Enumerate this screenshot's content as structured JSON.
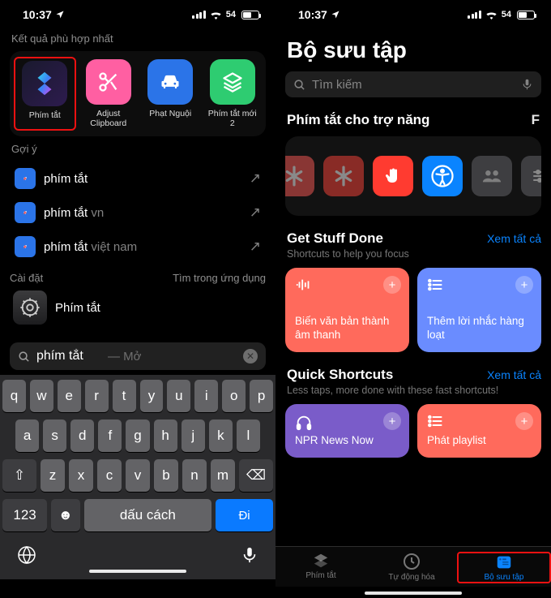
{
  "statusbar": {
    "time": "10:37",
    "battery": "54"
  },
  "left": {
    "best_label": "Kết quả phù hợp nhất",
    "apps": [
      {
        "name": "Phím tắt",
        "bg": "linear-gradient(135deg,#1a1a2e,#2d1b4e)",
        "icon": "shortcuts"
      },
      {
        "name": "Adjust Clipboard",
        "bg": "#ff5fa2",
        "icon": "scissors"
      },
      {
        "name": "Phạt Nguội",
        "bg": "#2b74e8",
        "icon": "car"
      },
      {
        "name": "Phím tắt mới 2",
        "bg": "#2ecc71",
        "icon": "layers"
      }
    ],
    "sugg_label": "Gợi ý",
    "suggestions": [
      {
        "main": "phím tắt",
        "sub": ""
      },
      {
        "main": "phím tắt",
        "sub": " vn"
      },
      {
        "main": "phím tắt",
        "sub": " việt nam"
      }
    ],
    "settings_label": "Cài đặt",
    "search_in_app": "Tìm trong ứng dụng",
    "settings_item": "Phím tắt",
    "search_value": "phím tắt",
    "search_hint": "— Mở",
    "keyboard": {
      "r1": [
        "q",
        "w",
        "e",
        "r",
        "t",
        "y",
        "u",
        "i",
        "o",
        "p"
      ],
      "r2": [
        "a",
        "s",
        "d",
        "f",
        "g",
        "h",
        "j",
        "k",
        "l"
      ],
      "r3_shift": "⇧",
      "r3_keys": [
        "z",
        "x",
        "c",
        "v",
        "b",
        "n",
        "m"
      ],
      "r3_del": "⌫",
      "num": "123",
      "emoji": "☻",
      "space": "dấu cách",
      "go": "Đi"
    }
  },
  "right": {
    "title": "Bộ sưu tập",
    "search_ph": "Tìm kiếm",
    "sect_a11y": "Phím tắt cho trợ năng",
    "peek_letter": "F",
    "a11y_items": [
      {
        "bg": "#ff5b57"
      },
      {
        "bg": "#ff453a"
      },
      {
        "bg": "#ff3b30"
      },
      {
        "bg": "#0a84ff",
        "active": true
      },
      {
        "bg": "#6b6b70"
      },
      {
        "bg": "#6b6b70"
      }
    ],
    "gsd": {
      "heading": "Get Stuff Done",
      "sub": "Shortcuts to help you focus",
      "see_all": "Xem tất cả",
      "cards": [
        {
          "bg": "#ff6a5c",
          "title": "Biến văn bản thành âm thanh",
          "icon": "wave"
        },
        {
          "bg": "#6a8cff",
          "title": "Thêm lời nhắc hàng loạt",
          "icon": "list"
        }
      ]
    },
    "qs": {
      "heading": "Quick Shortcuts",
      "sub": "Less taps, more done with these fast shortcuts!",
      "see_all": "Xem tất cả",
      "cards": [
        {
          "bg": "#7a5cc9",
          "title": "NPR News Now",
          "icon": "headphones"
        },
        {
          "bg": "#ff6a5c",
          "title": "Phát playlist",
          "icon": "list"
        }
      ]
    },
    "tabs": [
      {
        "label": "Phím tắt",
        "icon": "stack"
      },
      {
        "label": "Tự động hóa",
        "icon": "clock"
      },
      {
        "label": "Bộ sưu tập",
        "icon": "grid",
        "active": true
      }
    ]
  }
}
